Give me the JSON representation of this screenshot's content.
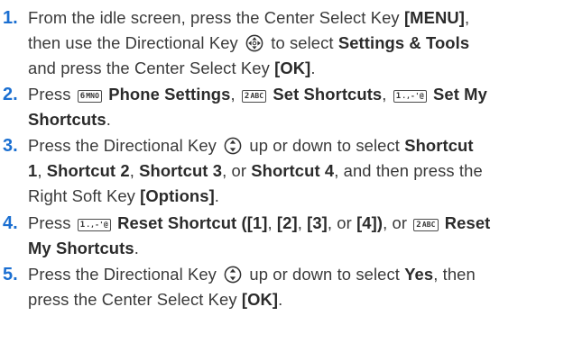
{
  "steps": [
    {
      "num": "1.",
      "l1": {
        "t1": "From the idle screen, press the Center Select Key ",
        "b1": "[MENU]",
        "t2": ","
      },
      "l2": {
        "t1": "then use the Directional Key ",
        "t2": " to select ",
        "b1": "Settings & Tools"
      },
      "l3": {
        "t1": "and press the Center Select Key ",
        "b1": "[OK]",
        "t2": "."
      }
    },
    {
      "num": "2.",
      "l1": {
        "t1": "Press ",
        "b1": "Phone Settings",
        "t2": ", ",
        "b2": "Set Shortcuts",
        "t3": ", ",
        "b3": "Set My"
      },
      "l2": {
        "b1": "Shortcuts",
        "t1": "."
      }
    },
    {
      "num": "3.",
      "l1": {
        "t1": "Press the Directional Key ",
        "t2": " up or down to select ",
        "b1": "Shortcut"
      },
      "l2": {
        "b1": "1",
        "t1": ", ",
        "b2": "Shortcut 2",
        "t2": ", ",
        "b3": "Shortcut 3",
        "t3": ", or ",
        "b4": "Shortcut 4",
        "t4": ", and then press the"
      },
      "l3": {
        "t1": "Right Soft Key ",
        "b1": "[Options]",
        "t2": "."
      }
    },
    {
      "num": "4.",
      "l1": {
        "t1": "Press ",
        "b1": "Reset Shortcut ([1]",
        "t2": ", ",
        "b2": "[2]",
        "t3": ", ",
        "b3": "[3]",
        "t4": ", or ",
        "b4": "[4])",
        "t5": ", or ",
        "b5": "Reset"
      },
      "l2": {
        "b1": "My Shortcuts",
        "t1": "."
      }
    },
    {
      "num": "5.",
      "l1": {
        "t1": "Press the Directional Key ",
        "t2": " up or down to select ",
        "b1": "Yes",
        "t3": ", then"
      },
      "l2": {
        "t1": "press the Center Select Key ",
        "b1": "[OK]",
        "t2": "."
      }
    }
  ],
  "keys": {
    "k6": {
      "digit": "6",
      "letters": "MNO"
    },
    "k2": {
      "digit": "2",
      "letters": "ABC"
    },
    "k1": {
      "digit": "1",
      "letters": ".,-'@"
    }
  },
  "icons": {
    "four_way": "directional-key-four-way-icon",
    "up_down": "directional-key-up-down-icon"
  },
  "colors": {
    "step_number": "#1b6fd1",
    "text": "#3a3a3a"
  }
}
